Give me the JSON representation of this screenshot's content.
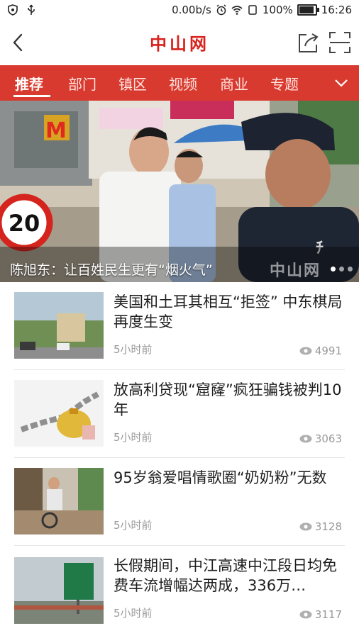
{
  "status_bar": {
    "network_speed": "0.00b/s",
    "battery": "100%",
    "battery_level": 1.0,
    "time": "16:26"
  },
  "header": {
    "title": "中山网",
    "back_icon": "back-arrow-icon",
    "share_icon": "share-icon",
    "scan_icon": "scan-icon"
  },
  "tabs": [
    {
      "label": "推荐",
      "active": true
    },
    {
      "label": "部门"
    },
    {
      "label": "镇区"
    },
    {
      "label": "视频"
    },
    {
      "label": "商业"
    },
    {
      "label": "专题"
    }
  ],
  "banner": {
    "caption": "陈旭东：让百姓民生更有“烟火气”",
    "watermark": "中山网",
    "speed_sign": "20",
    "dots": 3,
    "active_dot": 0
  },
  "news": [
    {
      "title": "美国和土耳其相互“拒签” 中东棋局再度生变",
      "time": "5小时前",
      "views": "4991"
    },
    {
      "title": "放高利贷现“窟窿”疯狂骗钱被判10年",
      "time": "5小时前",
      "views": "3063"
    },
    {
      "title": "95岁翁爱唱情歌圈“奶奶粉”无数",
      "time": "5小时前",
      "views": "3128"
    },
    {
      "title": "长假期间，中江高速中江段日均免费车流增幅达两成，336万…",
      "time": "5小时前",
      "views": "3117"
    }
  ],
  "colors": {
    "accent": "#d83a2f",
    "title_red": "#d8221d"
  }
}
